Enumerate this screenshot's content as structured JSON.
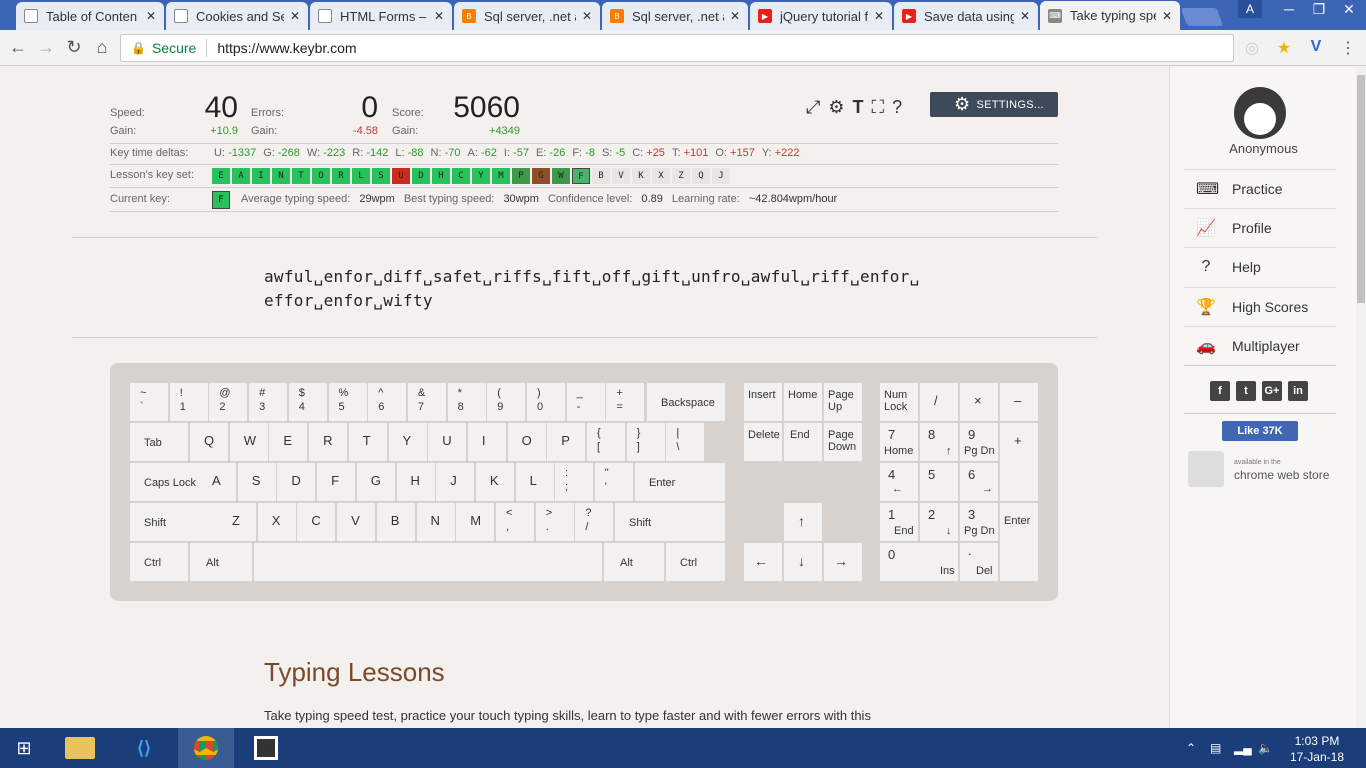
{
  "browser": {
    "tabs": [
      {
        "title": "Table of Conten",
        "icon": "page-icon"
      },
      {
        "title": "Cookies and Se",
        "icon": "page-icon"
      },
      {
        "title": "HTML Forms – ",
        "icon": "page-icon"
      },
      {
        "title": "Sql server, .net a",
        "icon": "blogger-icon"
      },
      {
        "title": "Sql server, .net a",
        "icon": "blogger-icon"
      },
      {
        "title": "jQuery tutorial f",
        "icon": "youtube-icon"
      },
      {
        "title": "Save data using",
        "icon": "youtube-icon"
      },
      {
        "title": "Take typing spe",
        "icon": "keybr-icon",
        "active": true
      }
    ],
    "profile_letter": "A",
    "secure_label": "Secure",
    "url": "https://www.keybr.com"
  },
  "stats": {
    "speed_label": "Speed:",
    "speed_value": "40",
    "speed_gain_label": "Gain:",
    "speed_gain": "+10.9",
    "errors_label": "Errors:",
    "errors_value": "0",
    "errors_gain_label": "Gain:",
    "errors_gain": "-4.58",
    "score_label": "Score:",
    "score_value": "5060",
    "score_gain_label": "Gain:",
    "score_gain": "+4349",
    "deltas_label": "Key time deltas:",
    "deltas": [
      {
        "key": "U:",
        "val": "-1337",
        "sign": "neg"
      },
      {
        "key": "G:",
        "val": "-268",
        "sign": "neg"
      },
      {
        "key": "W:",
        "val": "-223",
        "sign": "neg"
      },
      {
        "key": "R:",
        "val": "-142",
        "sign": "neg"
      },
      {
        "key": "L:",
        "val": "-88",
        "sign": "neg"
      },
      {
        "key": "N:",
        "val": "-70",
        "sign": "neg"
      },
      {
        "key": "A:",
        "val": "-62",
        "sign": "neg"
      },
      {
        "key": "I:",
        "val": "-57",
        "sign": "neg"
      },
      {
        "key": "E:",
        "val": "-26",
        "sign": "neg"
      },
      {
        "key": "F:",
        "val": "-8",
        "sign": "neg"
      },
      {
        "key": "S:",
        "val": "-5",
        "sign": "neg"
      },
      {
        "key": "C:",
        "val": "+25",
        "sign": "pos"
      },
      {
        "key": "T:",
        "val": "+101",
        "sign": "pos"
      },
      {
        "key": "O:",
        "val": "+157",
        "sign": "pos"
      },
      {
        "key": "Y:",
        "val": "+222",
        "sign": "pos"
      }
    ],
    "keyset_label": "Lesson's key set:",
    "keyset": [
      {
        "k": "E",
        "c": "g"
      },
      {
        "k": "A",
        "c": "g"
      },
      {
        "k": "I",
        "c": "g"
      },
      {
        "k": "N",
        "c": "g"
      },
      {
        "k": "T",
        "c": "g"
      },
      {
        "k": "O",
        "c": "g"
      },
      {
        "k": "R",
        "c": "g"
      },
      {
        "k": "L",
        "c": "g"
      },
      {
        "k": "S",
        "c": "g"
      },
      {
        "k": "U",
        "c": "r"
      },
      {
        "k": "D",
        "c": "g"
      },
      {
        "k": "H",
        "c": "g"
      },
      {
        "k": "C",
        "c": "g"
      },
      {
        "k": "Y",
        "c": "g"
      },
      {
        "k": "M",
        "c": "g"
      },
      {
        "k": "P",
        "c": "dg"
      },
      {
        "k": "G",
        "c": "br"
      },
      {
        "k": "W",
        "c": "dg"
      },
      {
        "k": "F",
        "c": "gs"
      },
      {
        "k": "B",
        "c": ""
      },
      {
        "k": "V",
        "c": ""
      },
      {
        "k": "K",
        "c": ""
      },
      {
        "k": "X",
        "c": ""
      },
      {
        "k": "Z",
        "c": ""
      },
      {
        "k": "Q",
        "c": ""
      },
      {
        "k": "J",
        "c": ""
      }
    ],
    "current_key_label": "Current key:",
    "current_key": "F",
    "avg_speed_label": "Average typing speed:",
    "avg_speed": "29wpm",
    "best_speed_label": "Best typing speed:",
    "best_speed": "30wpm",
    "confidence_label": "Confidence level:",
    "confidence": "0.89",
    "learning_label": "Learning rate:",
    "learning": "~42.804wpm/hour",
    "settings_label": "SETTINGS..."
  },
  "lesson_text": {
    "line1": "awful␣enfor␣diff␣safet␣riffs␣fift␣off␣gift␣unfro␣awful␣riff␣enfor␣",
    "line2": "effor␣enfor␣wifty"
  },
  "keyboard": {
    "row1": [
      [
        "~",
        "`"
      ],
      [
        "!",
        "1"
      ],
      [
        "@",
        "2"
      ],
      [
        "#",
        "3"
      ],
      [
        "$",
        "4"
      ],
      [
        "%",
        "5"
      ],
      [
        "^",
        "6"
      ],
      [
        "&",
        "7"
      ],
      [
        "*",
        "8"
      ],
      [
        "(",
        "9"
      ],
      [
        ")",
        "0"
      ],
      [
        "_",
        "-"
      ],
      [
        "+",
        "="
      ]
    ],
    "backspace": "Backspace",
    "tab": "Tab",
    "row2": [
      "Q",
      "W",
      "E",
      "R",
      "T",
      "Y",
      "U",
      "I",
      "O",
      "P"
    ],
    "row2_sym": [
      [
        "{",
        "["
      ],
      [
        "}",
        "]"
      ],
      [
        "|",
        "\\"
      ]
    ],
    "caps": "Caps Lock",
    "row3": [
      "A",
      "S",
      "D",
      "F",
      "G",
      "H",
      "J",
      "K",
      "L"
    ],
    "row3_sym": [
      [
        ":",
        ";"
      ],
      [
        "\"",
        "'"
      ]
    ],
    "enter": "Enter",
    "shift": "Shift",
    "row4": [
      "Z",
      "X",
      "C",
      "V",
      "B",
      "N",
      "M"
    ],
    "row4_sym": [
      [
        "<",
        ","
      ],
      [
        ">",
        "."
      ],
      [
        "?",
        "/"
      ]
    ],
    "ctrl": "Ctrl",
    "alt": "Alt",
    "insert": "Insert",
    "home": "Home",
    "pageup": "Page Up",
    "delete": "Delete",
    "end": "End",
    "pagedown": "Page Down",
    "numlock": "Num Lock",
    "slash": "/",
    "times": "×",
    "minus": "–",
    "plus": "+",
    "arrow_up": "↑",
    "arrow_left": "←",
    "arrow_down": "↓",
    "arrow_right": "→",
    "np7": [
      "7",
      "Home"
    ],
    "np8": [
      "8",
      "↑"
    ],
    "np9": [
      "9",
      "Pg Dn"
    ],
    "np4": [
      "4",
      "←"
    ],
    "np5": [
      "5",
      ""
    ],
    "np6": [
      "6",
      "→"
    ],
    "np1": [
      "1",
      "End"
    ],
    "np2": [
      "2",
      "↓"
    ],
    "np3": [
      "3",
      "Pg Dn"
    ],
    "np0": [
      "0",
      "Ins"
    ],
    "npdot": [
      ".",
      "Del"
    ],
    "npenter": "Enter"
  },
  "content": {
    "heading": "Typing Lessons",
    "paragraph": "Take typing speed test, practice your touch typing skills, learn to type faster and with fewer errors with this"
  },
  "sidebar": {
    "user": "Anonymous",
    "menu": [
      {
        "label": "Practice",
        "icon": "keyboard-icon"
      },
      {
        "label": "Profile",
        "icon": "chart-icon"
      },
      {
        "label": "Help",
        "icon": "help-icon"
      },
      {
        "label": "High Scores",
        "icon": "trophy-icon"
      },
      {
        "label": "Multiplayer",
        "icon": "car-icon"
      }
    ],
    "like_label": "Like 37K",
    "cws_small": "available in the",
    "cws_big": "chrome web store"
  },
  "taskbar": {
    "time": "1:03 PM",
    "date": "17-Jan-18"
  },
  "colors": {
    "tabstrip": "#3c65b5",
    "taskbar": "#1b3d7a",
    "key_green": "#27c25c",
    "key_red": "#cc2a1a",
    "heading_brown": "#7a4a2c",
    "settings_button": "#3e4a5a"
  }
}
